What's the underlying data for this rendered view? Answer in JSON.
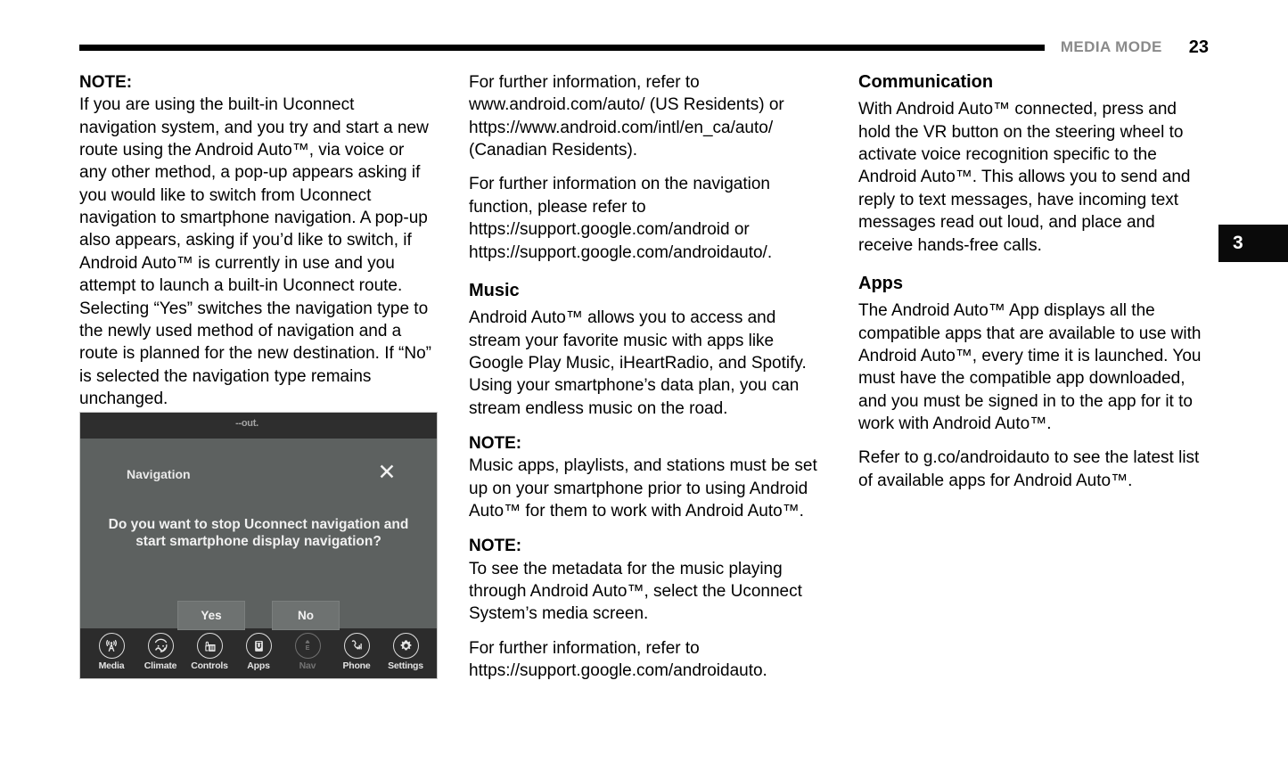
{
  "header": {
    "title": "MEDIA MODE",
    "page_number": "23"
  },
  "section_tab": {
    "number": "3"
  },
  "columns": {
    "left": {
      "note_label": "NOTE:",
      "note_body": "If you are using the built-in Uconnect navigation system, and you try and start a new route using the Android Auto™, via voice or any other method, a pop-up appears asking if you would like to switch from Uconnect navigation to smartphone navigation. A pop-up also appears, asking if you’d like to switch, if Android Auto™ is currently in use and you attempt to launch a built-in Uconnect route. Selecting “Yes” switches the navigation type to the newly used method of navigation and a route is planned for the new destination. If “No” is selected the navigation type remains unchanged."
    },
    "middle": {
      "para_1": "For further information, refer to www.android.com/auto/ (US Residents) or https://www.android.com/intl/en_ca/auto/ (Canadian Residents).",
      "para_2": "For further information on the navigation function, please refer to https://support.google.com/android or https://support.google.com/androidauto/.",
      "music_heading": "Music",
      "music_body": "Android Auto™ allows you to access and stream your favorite music with apps like Google Play Music, iHeartRadio, and Spotify. Using your smartphone’s data plan, you can stream endless music on the road.",
      "note_1_label": "NOTE:",
      "note_1_body": "Music apps, playlists, and stations must be set up on your smartphone prior to using Android Auto™ for them to work with Android Auto™.",
      "note_2_label": "NOTE:",
      "note_2_body": "To see the metadata for the music playing through Android Auto™, select the Uconnect System’s media screen.",
      "para_3": "For further information, refer to https://support.google.com/androidauto."
    },
    "right": {
      "communication_heading": "Communication",
      "communication_body": "With Android Auto™ connected, press and hold the VR button on the steering wheel to activate voice recognition specific to the Android Auto™. This allows you to send and reply to text messages, have incoming text messages read out loud, and place and receive hands-free calls.",
      "apps_heading": "Apps",
      "apps_body": "The Android Auto™ App displays all the compatible apps that are available to use with Android Auto™, every time it is launched. You must have the compatible app downloaded, and you must be signed in to the app for it to work with Android Auto™.",
      "apps_refer": "Refer to g.co/androidauto to see the latest list of available apps for Android Auto™."
    }
  },
  "figure": {
    "status_text": "--out.",
    "dialog_title": "Navigation",
    "close_label": "✕",
    "prompt": "Do you want to stop Uconnect navigation and start smartphone display navigation?",
    "button_yes": "Yes",
    "button_no": "No",
    "nav_items": [
      {
        "label": "Media",
        "icon": "radio-tower-icon",
        "dim": false
      },
      {
        "label": "Climate",
        "icon": "climate-fan-icon",
        "dim": false
      },
      {
        "label": "Controls",
        "icon": "vehicle-controls-icon",
        "dim": false
      },
      {
        "label": "Apps",
        "icon": "uconnect-apps-icon",
        "dim": false
      },
      {
        "label": "Nav",
        "icon": "compass-nav-icon",
        "dim": true
      },
      {
        "label": "Phone",
        "icon": "phone-signal-icon",
        "dim": false
      },
      {
        "label": "Settings",
        "icon": "gear-settings-icon",
        "dim": false
      }
    ]
  },
  "colors": {
    "page_background": "#ffffff",
    "text": "#000000",
    "header_title": "#8a8a8a",
    "tab_background": "#0a0a0a",
    "screen_statusbar": "#2e2e2e",
    "screen_body": "#5d6160",
    "screen_navbar": "#2c2c2c"
  }
}
